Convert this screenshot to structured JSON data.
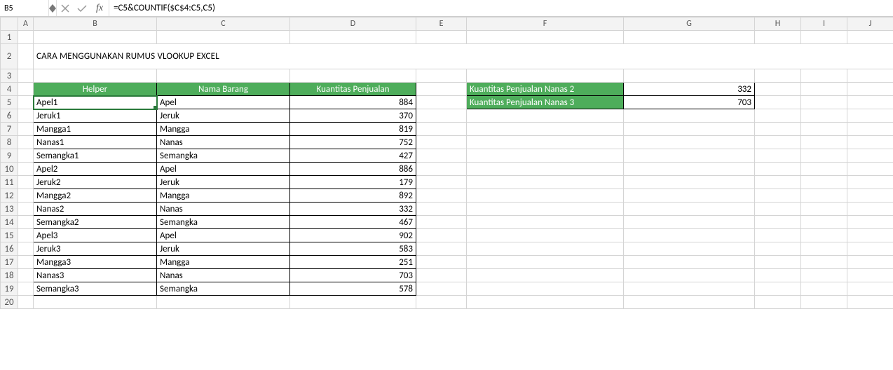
{
  "name_box": "B5",
  "formula": "=C5&COUNTIF($C$4:C5,C5)",
  "fx_label": "fx",
  "columns": [
    "A",
    "B",
    "C",
    "D",
    "E",
    "F",
    "G",
    "H",
    "I",
    "J"
  ],
  "title": "CARA MENGGUNAKAN RUMUS VLOOKUP EXCEL",
  "table1": {
    "headers": [
      "Helper",
      "Nama Barang",
      "Kuantitas Penjualan"
    ],
    "rows": [
      {
        "helper": "Apel1",
        "nama": "Apel",
        "qty": 884
      },
      {
        "helper": "Jeruk1",
        "nama": "Jeruk",
        "qty": 370
      },
      {
        "helper": "Mangga1",
        "nama": "Mangga",
        "qty": 819
      },
      {
        "helper": "Nanas1",
        "nama": "Nanas",
        "qty": 752
      },
      {
        "helper": "Semangka1",
        "nama": "Semangka",
        "qty": 427
      },
      {
        "helper": "Apel2",
        "nama": "Apel",
        "qty": 886
      },
      {
        "helper": "Jeruk2",
        "nama": "Jeruk",
        "qty": 179
      },
      {
        "helper": "Mangga2",
        "nama": "Mangga",
        "qty": 892
      },
      {
        "helper": "Nanas2",
        "nama": "Nanas",
        "qty": 332
      },
      {
        "helper": "Semangka2",
        "nama": "Semangka",
        "qty": 467
      },
      {
        "helper": "Apel3",
        "nama": "Apel",
        "qty": 902
      },
      {
        "helper": "Jeruk3",
        "nama": "Jeruk",
        "qty": 583
      },
      {
        "helper": "Mangga3",
        "nama": "Mangga",
        "qty": 251
      },
      {
        "helper": "Nanas3",
        "nama": "Nanas",
        "qty": 703
      },
      {
        "helper": "Semangka3",
        "nama": "Semangka",
        "qty": 578
      }
    ]
  },
  "lookup": {
    "rows": [
      {
        "label": "Kuantitas Penjualan Nanas 2",
        "value": 332
      },
      {
        "label": "Kuantitas Penjualan Nanas 3",
        "value": 703
      }
    ]
  },
  "colors": {
    "header_green": "#4ead5b",
    "selection": "#2a7a3b"
  }
}
